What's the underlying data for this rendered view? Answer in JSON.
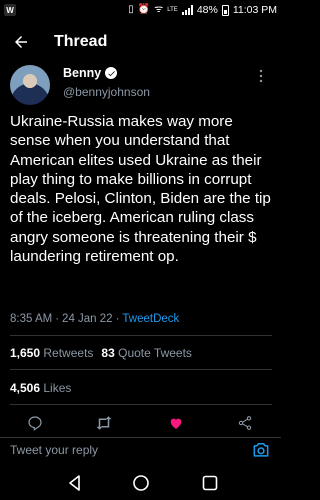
{
  "status_bar": {
    "app_badge": "W",
    "battery": "48%",
    "time": "11:03 PM",
    "network": "LTE"
  },
  "header": {
    "title": "Thread"
  },
  "author": {
    "name": "Benny",
    "handle": "@bennyjohnson"
  },
  "tweet": {
    "text": "Ukraine-Russia makes way more sense when you understand that American elites used Ukraine as their play thing to make billions in corrupt deals. Pelosi, Clinton, Biden are the tip of the iceberg. American ruling class angry someone is threatening their $ laundering retirement op.",
    "time": "8:35 AM",
    "date": "24 Jan 22",
    "separator": "·",
    "client": "TweetDeck"
  },
  "stats": {
    "retweets_count": "1,650",
    "retweets_label": "Retweets",
    "quotes_count": "83",
    "quotes_label": "Quote Tweets",
    "likes_count": "4,506",
    "likes_label": "Likes"
  },
  "reply": {
    "placeholder": "Tweet your reply"
  },
  "colors": {
    "accent": "#1d9bf0",
    "like": "#f91880",
    "muted": "#8b98a5"
  }
}
